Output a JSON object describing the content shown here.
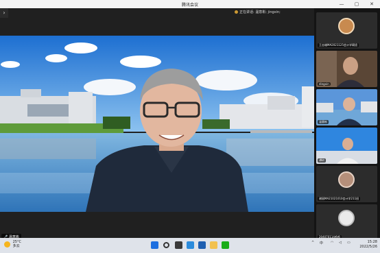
{
  "window": {
    "title": "腾讯会议",
    "minimize_icon": "—",
    "maximize_icon": "▢",
    "close_icon": "✕"
  },
  "meeting": {
    "collapse_icon": "›",
    "speaking_text": "正在讲话: 温意彬; jingxin;",
    "main_speaker_name": "温意彬"
  },
  "participants": [
    {
      "name": "王志雄MA2021125会计学硕班"
    },
    {
      "name": "dingxin"
    },
    {
      "name": "温意彬"
    },
    {
      "name": "谭树"
    },
    {
      "name": "谢丽MA21021010会计学211班"
    },
    {
      "name": "204070114鸡鸡"
    }
  ],
  "taskbar": {
    "weather_temp": "25°C",
    "weather_desc": "多云",
    "ime": "中",
    "time": "15:28",
    "date": "2022/5/26"
  }
}
